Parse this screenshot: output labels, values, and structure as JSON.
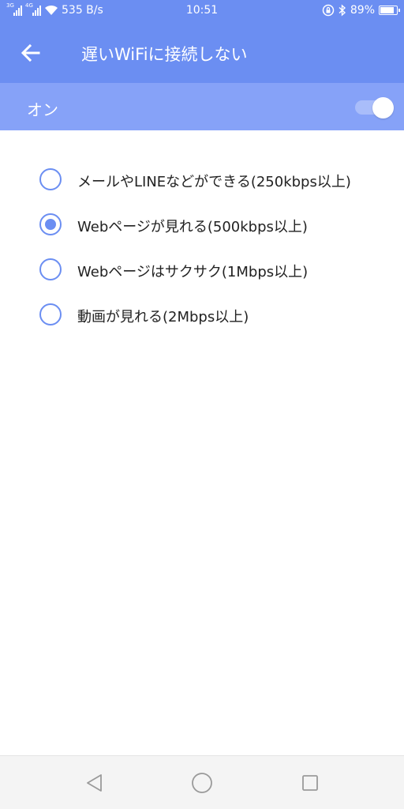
{
  "status_bar": {
    "network_1": "3G",
    "network_2": "4G",
    "speed": "535 B/s",
    "time": "10:51",
    "battery": "89%",
    "battery_level": 0.89,
    "icons": [
      "signal-icon",
      "signal-icon",
      "wifi-icon",
      "lock-rotation-icon",
      "bluetooth-icon",
      "battery-icon"
    ]
  },
  "app_bar": {
    "back_icon": "arrow-left-icon",
    "title": "遅いWiFiに接続しない"
  },
  "toggle": {
    "label": "オン",
    "on": true
  },
  "options": [
    {
      "label": "メールやLINEなどができる(250kbps以上)",
      "selected": false
    },
    {
      "label": "Webページが見れる(500kbps以上)",
      "selected": true
    },
    {
      "label": "Webページはサクサク(1Mbps以上)",
      "selected": false
    },
    {
      "label": "動画が見れる(2Mbps以上)",
      "selected": false
    }
  ],
  "nav_bar": {
    "icons": [
      "back-triangle-icon",
      "home-circle-icon",
      "recents-square-icon"
    ]
  },
  "colors": {
    "accent": "#6b8ef2",
    "toggle_row": "#86a2f8",
    "text": "#222222",
    "nav_background": "#f4f4f4"
  }
}
